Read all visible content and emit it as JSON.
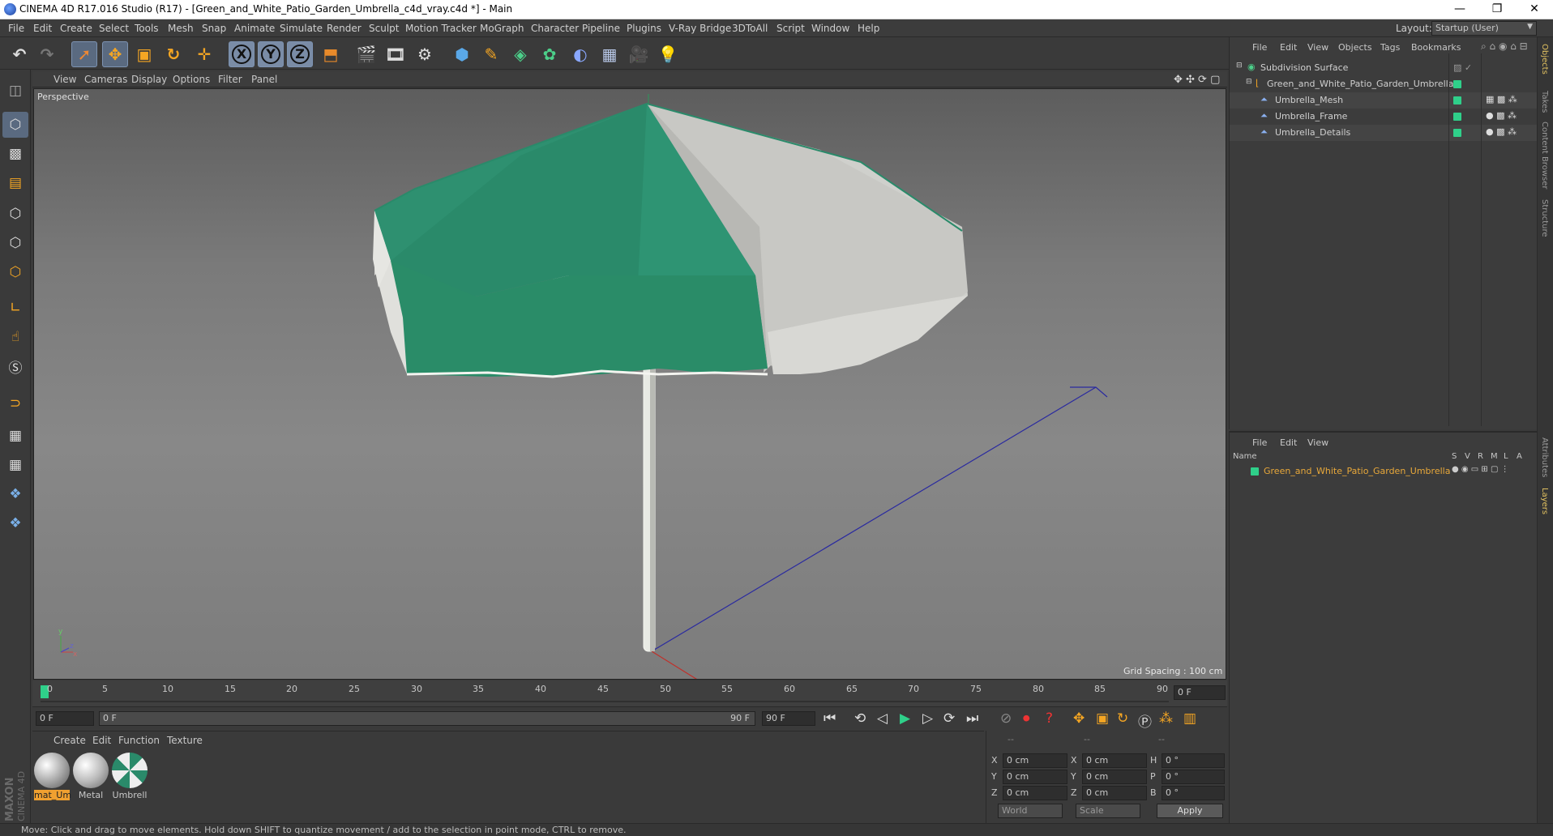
{
  "window": {
    "title": "CINEMA 4D R17.016 Studio (R17) - [Green_and_White_Patio_Garden_Umbrella_c4d_vray.c4d *] - Main",
    "minimize": "—",
    "restore": "❐",
    "close": "✕"
  },
  "menu": [
    "File",
    "Edit",
    "Create",
    "Select",
    "Tools",
    "Mesh",
    "Snap",
    "Animate",
    "Simulate",
    "Render",
    "Sculpt",
    "Motion Tracker",
    "MoGraph",
    "Character",
    "Pipeline",
    "Plugins",
    "V-Ray Bridge",
    "3DToAll",
    "Script",
    "Window",
    "Help"
  ],
  "layout": {
    "label": "Layout:",
    "value": "Startup (User)"
  },
  "toolbar": {
    "icons": [
      "undo-icon",
      "redo-icon",
      "live-selection-icon",
      "move-icon",
      "scale-icon",
      "rotate-icon",
      "transform-icon",
      "x-axis-icon",
      "y-axis-icon",
      "z-axis-icon",
      "coordinate-system-icon",
      "render-view-icon",
      "render-picture-viewer-icon",
      "edit-render-settings-icon",
      "cube-icon",
      "pen-icon",
      "subdivision-icon",
      "cloner-icon",
      "deformer-icon",
      "floor-icon",
      "camera-icon",
      "light-icon"
    ],
    "axis_labels": [
      "X",
      "Y",
      "Z"
    ]
  },
  "viewport": {
    "menu": [
      "View",
      "Cameras",
      "Display",
      "Options",
      "Filter",
      "Panel"
    ],
    "label": "Perspective",
    "grid_spacing": "Grid Spacing : 100 cm",
    "axis_x": "x",
    "axis_y": "y",
    "axis_z": "z"
  },
  "timeline": {
    "ticks": [
      "0",
      "5",
      "10",
      "15",
      "20",
      "25",
      "30",
      "35",
      "40",
      "45",
      "50",
      "55",
      "60",
      "65",
      "70",
      "75",
      "80",
      "85",
      "90"
    ],
    "current_frame": "0 F",
    "start_field": "0 F",
    "range_start": "0 F",
    "range_end": "90 F",
    "end_field": "90 F"
  },
  "materials": {
    "menu": [
      "Create",
      "Edit",
      "Function",
      "Texture"
    ],
    "items": [
      {
        "name": "mat_Um",
        "selected": true
      },
      {
        "name": "Metal",
        "selected": false
      },
      {
        "name": "Umbrell",
        "selected": false
      }
    ]
  },
  "attributes": {
    "headers": [
      "--",
      "--",
      "--"
    ],
    "rows": [
      {
        "a": "X",
        "av": "0 cm",
        "b": "X",
        "bv": "0 cm",
        "c": "H",
        "cv": "0 °"
      },
      {
        "a": "Y",
        "av": "0 cm",
        "b": "Y",
        "bv": "0 cm",
        "c": "P",
        "cv": "0 °"
      },
      {
        "a": "Z",
        "av": "0 cm",
        "b": "Z",
        "bv": "0 cm",
        "c": "B",
        "cv": "0 °"
      }
    ],
    "world": "World",
    "scale": "Scale",
    "apply": "Apply"
  },
  "status": "Move: Click and drag to move elements. Hold down SHIFT to quantize movement / add to the selection in point mode, CTRL to remove.",
  "objects_panel": {
    "menu": [
      "File",
      "Edit",
      "View",
      "Objects",
      "Tags",
      "Bookmarks"
    ],
    "items": [
      {
        "name": "Subdivision Surface",
        "level": 0
      },
      {
        "name": "Green_and_White_Patio_Garden_Umbrella",
        "level": 1
      },
      {
        "name": "Umbrella_Mesh",
        "level": 2
      },
      {
        "name": "Umbrella_Frame",
        "level": 2
      },
      {
        "name": "Umbrella_Details",
        "level": 2
      }
    ]
  },
  "layers_panel": {
    "menu": [
      "File",
      "Edit",
      "View"
    ],
    "columns": [
      "Name",
      "S",
      "V",
      "R",
      "M",
      "L",
      "A"
    ],
    "layer_name": "Green_and_White_Patio_Garden_Umbrella"
  },
  "side_tabs": [
    "Objects",
    "Takes",
    "Content Browser",
    "Structure",
    "Attributes",
    "Layers"
  ],
  "logo": {
    "brand": "MAXON",
    "product": "CINEMA 4D"
  },
  "colors": {
    "accent_green": "#2fd08a",
    "umbrella_green": "#2a8a6a",
    "selection_orange": "#f0a030",
    "layer_name_orange": "#e8a83a"
  }
}
